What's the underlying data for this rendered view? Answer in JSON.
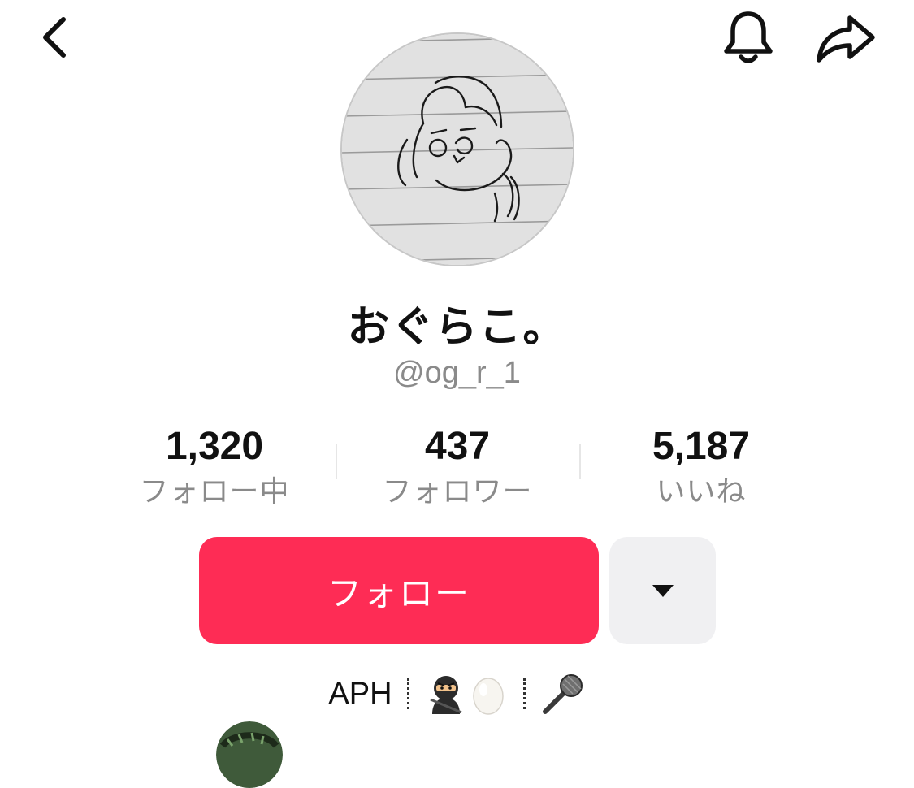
{
  "header": {
    "back_icon": "chevron-left-icon",
    "bell_icon": "bell-icon",
    "share_icon": "share-arrow-icon"
  },
  "profile": {
    "display_name": "おぐらこ。",
    "username": "@og_r_1",
    "avatar": "hand-drawn-face-on-lined-paper"
  },
  "stats": [
    {
      "value": "1,320",
      "label": "フォロー中"
    },
    {
      "value": "437",
      "label": "フォロワー"
    },
    {
      "value": "5,187",
      "label": "いいね"
    }
  ],
  "actions": {
    "follow_label": "フォロー",
    "more_icon": "caret-down-icon"
  },
  "bio": {
    "text": "APH",
    "emojis": [
      "ninja-emoji",
      "egg-emoji",
      "microphone-emoji"
    ]
  },
  "colors": {
    "accent": "#fe2c55",
    "secondary_text": "#8a8a8a",
    "more_button_bg": "#f0f0f2"
  }
}
